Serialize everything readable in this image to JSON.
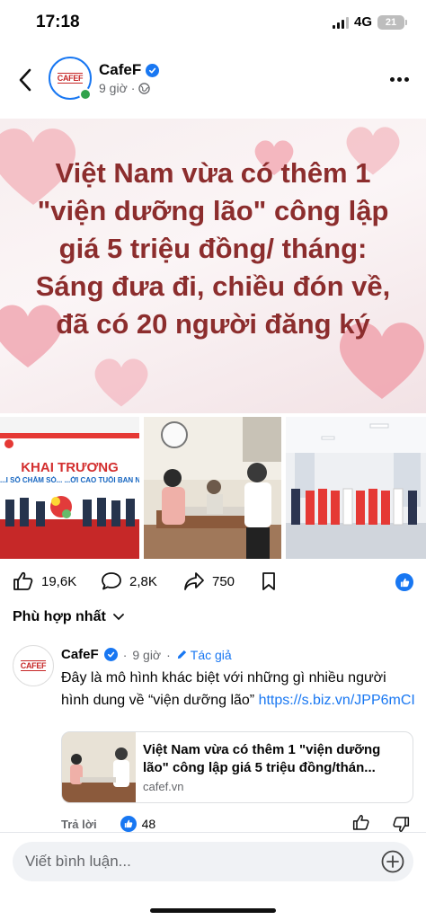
{
  "status_bar": {
    "time": "17:18",
    "network": "4G",
    "battery": "21"
  },
  "post": {
    "page_name": "CafeF",
    "time": "9 giờ",
    "avatar_logo": "CAFEF",
    "headline": "Việt Nam vừa có thêm 1 \"viện dưỡng lão\" công lập giá 5 triệu đồng/ tháng: Sáng đưa đi, chiều đón về, đã có 20 người đăng ký",
    "photos": [
      {
        "banner_title": "KHAI TRƯƠNG",
        "banner_sub": "...I SỐ CHĂM SÓ... ...ỜI CAO TUỔI BAN N..."
      },
      {
        "name": "office-photo"
      },
      {
        "name": "hall-photo"
      }
    ],
    "reactions": {
      "likes": "19,6K",
      "comments": "2,8K",
      "shares": "750"
    }
  },
  "comments_section": {
    "sort_label": "Phù hợp nhất",
    "comment": {
      "author": "CafeF",
      "time": "9 giờ",
      "author_badge": "Tác giả",
      "text": "Đây là mô hình khác biệt với những gì nhiều người hình dung về “viện dưỡng lão” ",
      "link": "https://s.biz.vn/JPP6mCI",
      "card": {
        "title": "Việt Nam vừa có thêm 1 \"viện dưỡng lão\" công lập giá 5 triệu đồng/thán...",
        "domain": "cafef.vn"
      },
      "reply_label": "Trả lời",
      "like_count": "48"
    }
  },
  "composer": {
    "placeholder": "Viết bình luận..."
  },
  "colors": {
    "accent": "#1877f2",
    "headline_text": "#8c2d2d",
    "verified": "#1877f2",
    "online": "#31a24c"
  }
}
